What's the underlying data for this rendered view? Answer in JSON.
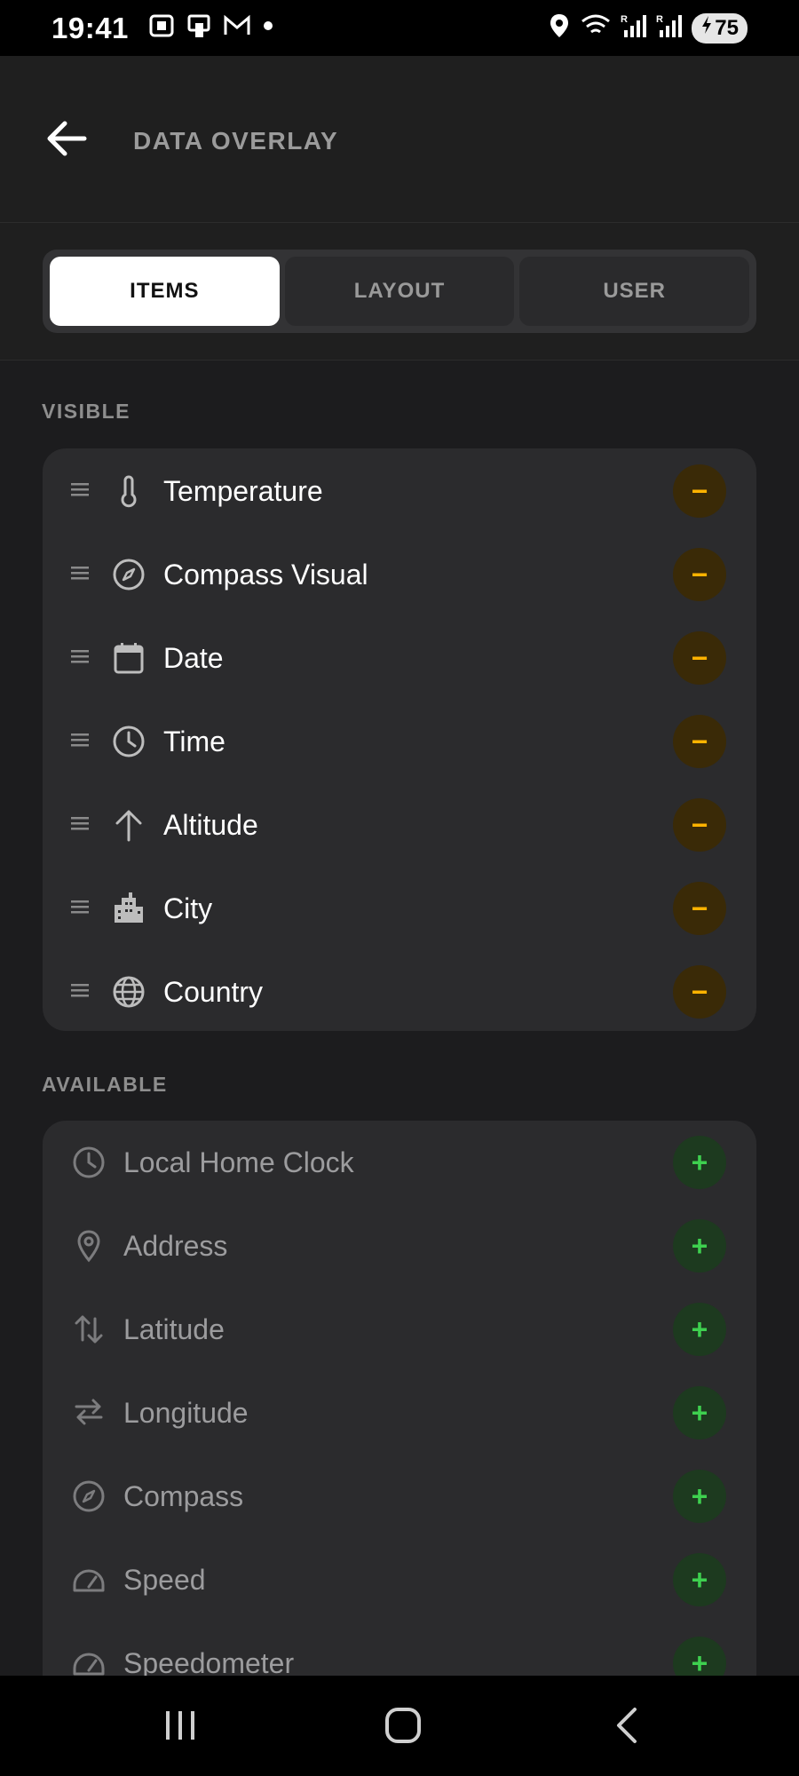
{
  "status_bar": {
    "time": "19:41",
    "battery": "75",
    "icons": [
      "screenshot-icon",
      "phone-icon",
      "gmail-icon",
      "dot-icon",
      "location-icon",
      "wifi-icon",
      "signal-r-icon",
      "signal-r-icon",
      "battery-charging-icon"
    ]
  },
  "header": {
    "title": "DATA OVERLAY",
    "back_icon": "arrow-left-icon"
  },
  "tabs": [
    {
      "label": "ITEMS",
      "active": true
    },
    {
      "label": "LAYOUT",
      "active": false
    },
    {
      "label": "USER",
      "active": false
    }
  ],
  "visible": {
    "label": "VISIBLE",
    "items": [
      {
        "label": "Temperature",
        "icon": "thermometer-icon"
      },
      {
        "label": "Compass Visual",
        "icon": "compass-icon"
      },
      {
        "label": "Date",
        "icon": "calendar-icon"
      },
      {
        "label": "Time",
        "icon": "clock-icon"
      },
      {
        "label": "Altitude",
        "icon": "arrow-up-icon"
      },
      {
        "label": "City",
        "icon": "city-icon"
      },
      {
        "label": "Country",
        "icon": "globe-icon"
      }
    ],
    "action_symbol": "−"
  },
  "available": {
    "label": "AVAILABLE",
    "items": [
      {
        "label": "Local Home Clock",
        "icon": "clock-icon"
      },
      {
        "label": "Address",
        "icon": "map-pin-icon"
      },
      {
        "label": "Latitude",
        "icon": "swap-vertical-icon"
      },
      {
        "label": "Longitude",
        "icon": "swap-horizontal-icon"
      },
      {
        "label": "Compass",
        "icon": "compass-icon"
      },
      {
        "label": "Speed",
        "icon": "speedometer-icon"
      },
      {
        "label": "Speedometer",
        "icon": "speedometer-icon"
      }
    ],
    "action_symbol": "+"
  },
  "nav_bar": {
    "buttons": [
      "recent-apps-icon",
      "home-icon",
      "back-icon"
    ]
  },
  "colors": {
    "background": "#1c1c1e",
    "card": "#2b2b2d",
    "remove_accent": "#ffb300",
    "add_accent": "#3ed04f"
  }
}
